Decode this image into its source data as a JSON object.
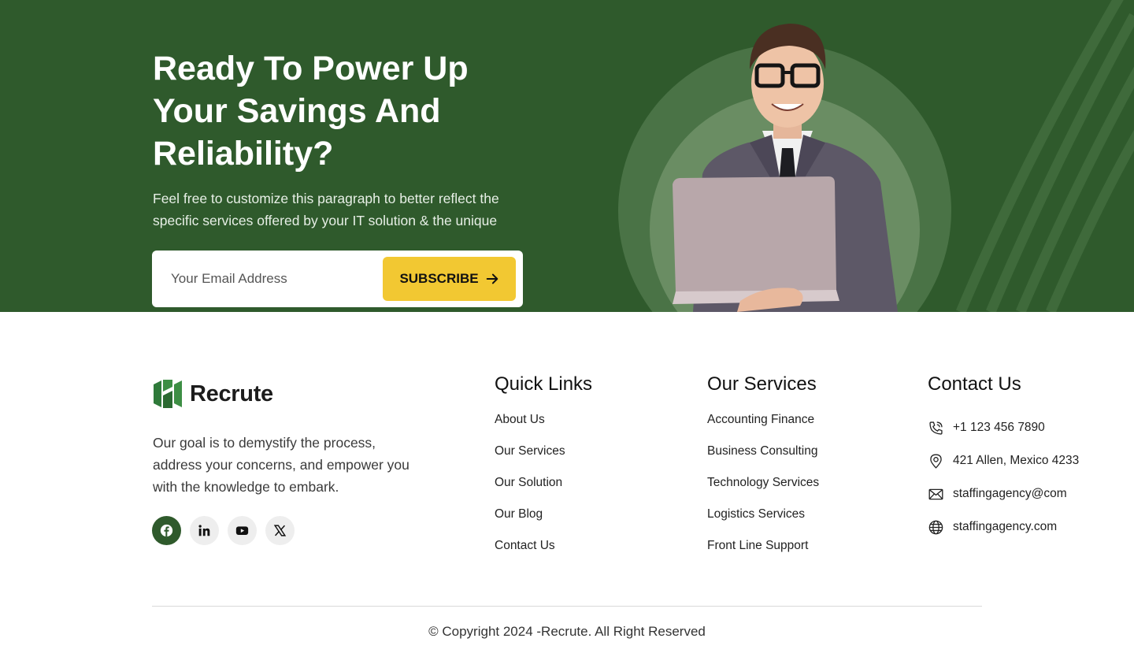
{
  "cta": {
    "title": "Ready To Power Up Your Savings And Reliability?",
    "text": "Feel free to customize this paragraph to better reflect the specific services offered by your IT solution & the unique",
    "email_placeholder": "Your Email Address",
    "subscribe_label": "SUBSCRIBE",
    "subscribe_icon": "arrow-right-icon"
  },
  "footer": {
    "brand": "Recrute",
    "about": "Our goal is to demystify the process, address your concerns, and empower you with the knowledge to embark.",
    "socials": [
      {
        "icon": "facebook-icon",
        "active": true
      },
      {
        "icon": "linkedin-icon",
        "active": false
      },
      {
        "icon": "youtube-icon",
        "active": false
      },
      {
        "icon": "x-icon",
        "active": false
      }
    ],
    "quick_links": {
      "title": "Quick Links",
      "items": [
        "About Us",
        "Our Services",
        "Our Solution",
        "Our Blog",
        "Contact Us"
      ]
    },
    "services": {
      "title": "Our Services",
      "items": [
        "Accounting Finance",
        "Business Consulting",
        "Technology Services",
        "Logistics Services",
        "Front Line Support"
      ]
    },
    "contact": {
      "title": "Contact Us",
      "phone": "+1 123 456 7890",
      "address": "421 Allen, Mexico 4233",
      "email": "staffingagency@com",
      "website": "staffingagency.com"
    },
    "copyright": "© Copyright 2024 -Recrute. All Right Reserved"
  },
  "colors": {
    "brand_green": "#2f5a2c",
    "accent_yellow": "#f2c832"
  }
}
